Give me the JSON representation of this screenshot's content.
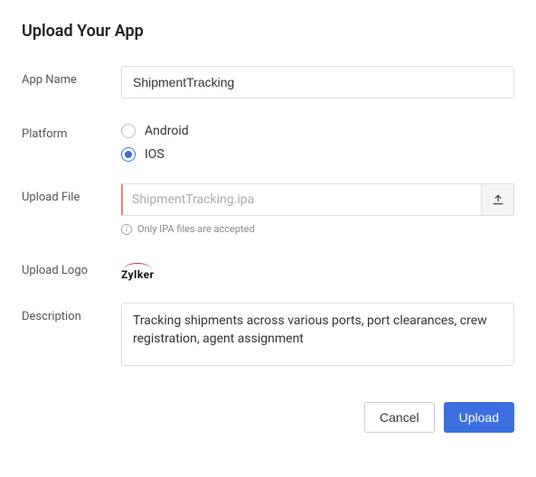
{
  "title": "Upload Your App",
  "labels": {
    "app_name": "App Name",
    "platform": "Platform",
    "upload_file": "Upload File",
    "upload_logo": "Upload Logo",
    "description": "Description"
  },
  "app_name": "ShipmentTracking",
  "platform": {
    "options": [
      "Android",
      "IOS"
    ],
    "selected": "IOS"
  },
  "upload_file": {
    "placeholder": "ShipmentTracking.ipa",
    "hint": "Only IPA files are accepted"
  },
  "logo": {
    "text": "Zylker"
  },
  "description": "Tracking shipments across various ports, port clearances, crew registration, agent assignment",
  "buttons": {
    "cancel": "Cancel",
    "upload": "Upload"
  }
}
